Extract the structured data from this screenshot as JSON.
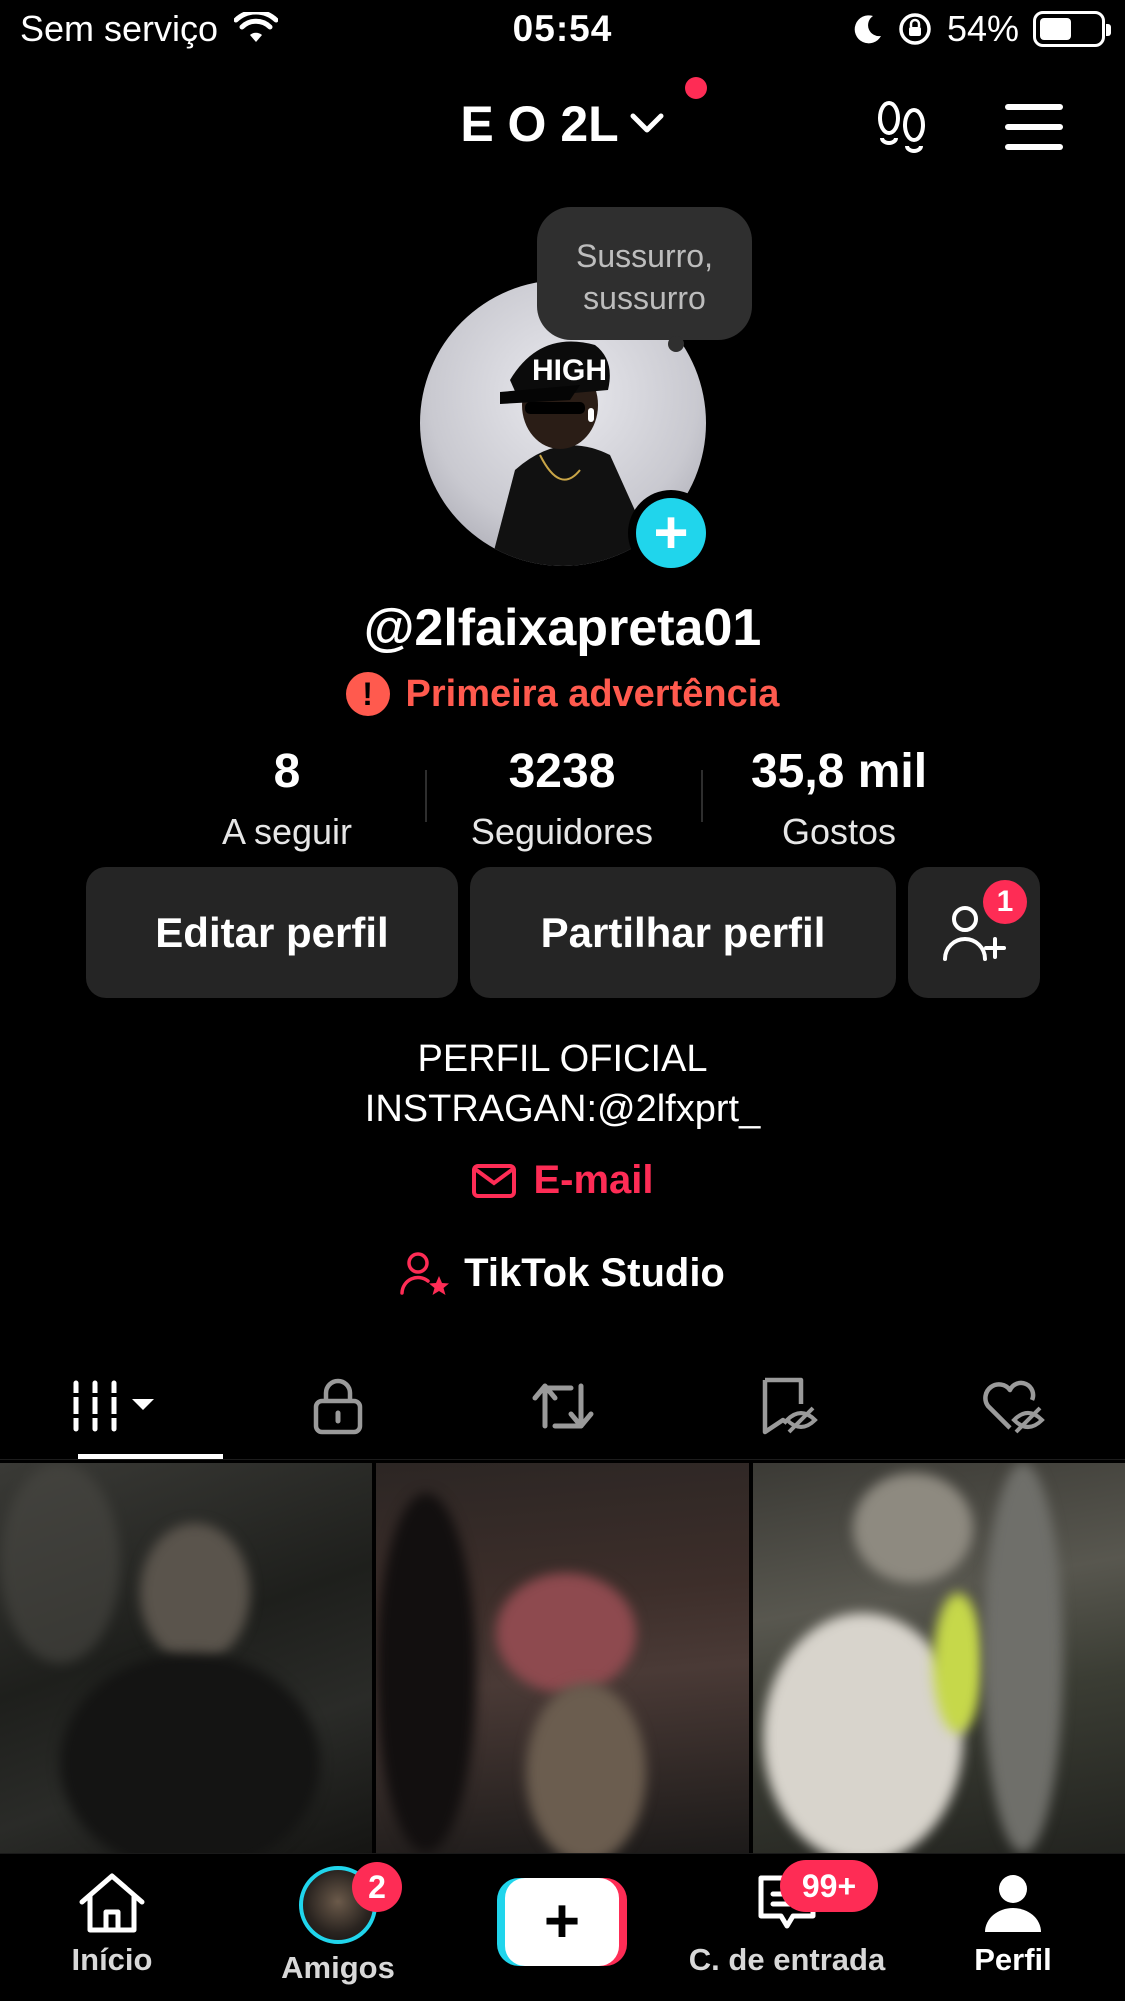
{
  "status_bar": {
    "carrier": "Sem serviço",
    "time": "05:54",
    "battery": "54%",
    "battery_level": 0.54
  },
  "header": {
    "title": "E O 2L",
    "icons": [
      "chevron-down-icon",
      "footprint-icon",
      "menu-icon"
    ]
  },
  "profile": {
    "bubble_text": "Sussurro, sussurro",
    "username": "@2lfaixapreta01",
    "warning": "Primeira advertência"
  },
  "stats": [
    {
      "value": "8",
      "label": "A seguir"
    },
    {
      "value": "3238",
      "label": "Seguidores"
    },
    {
      "value": "35,8 mil",
      "label": "Gostos"
    }
  ],
  "actions": {
    "edit": "Editar perfil",
    "share": "Partilhar perfil",
    "add_friend_badge": "1"
  },
  "bio": {
    "line1": "PERFIL OFICIAL",
    "line2": "INSTRAGAN:@2lfxprt_",
    "email": "E-mail",
    "studio": "TikTok Studio"
  },
  "tabs": [
    "videos-icon",
    "lock-icon",
    "repost-icon",
    "saved-icon",
    "liked-icon"
  ],
  "nav": {
    "home": "Início",
    "friends": "Amigos",
    "friends_badge": "2",
    "inbox": "C. de entrada",
    "inbox_badge": "99+",
    "profile": "Perfil"
  },
  "colors": {
    "accent": "#fe2c55",
    "cyan": "#20d5ec",
    "warning": "#ff5a4e",
    "button_bg": "#252525"
  }
}
